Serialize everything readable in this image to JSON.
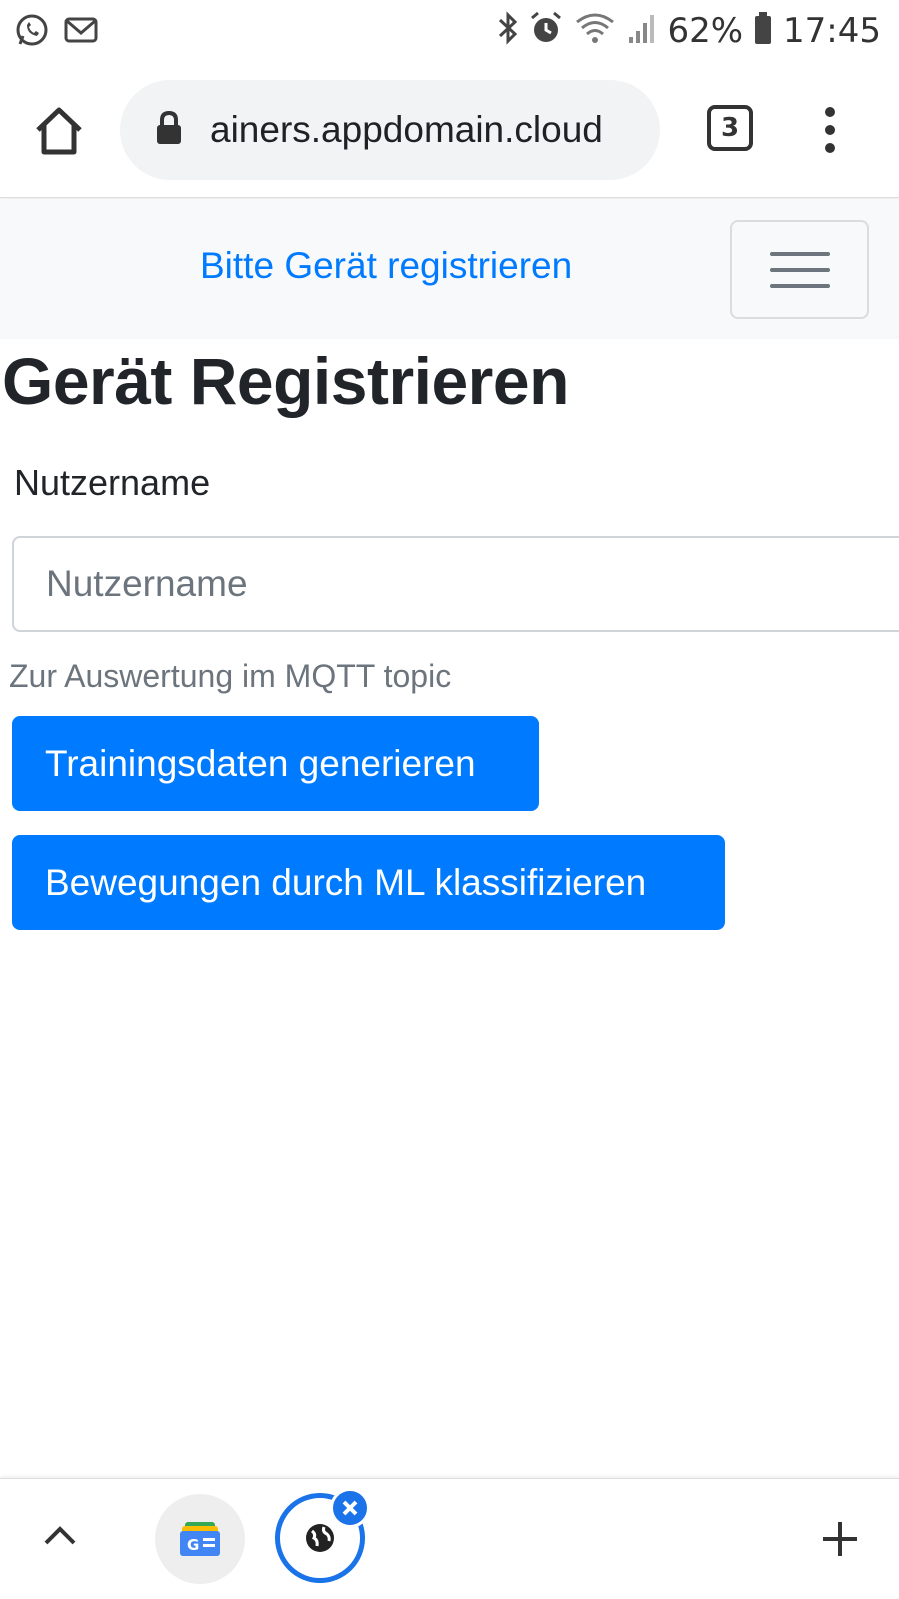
{
  "status_bar": {
    "battery": "62%",
    "time": "17:45",
    "left_icons": [
      "whatsapp-icon",
      "gmail-icon"
    ],
    "right_icons": [
      "bluetooth-icon",
      "alarm-icon",
      "wifi-icon",
      "signal-icon",
      "battery-icon"
    ]
  },
  "browser": {
    "url": "ainers.appdomain.cloud",
    "tab_count": "3"
  },
  "navbar": {
    "brand": "Bitte Gerät registrieren"
  },
  "main": {
    "title": "Gerät Registrieren",
    "username_label": "Nutzername",
    "username_placeholder": "Nutzername",
    "username_value": "",
    "help_text": "Zur Auswertung im MQTT topic",
    "buttons": {
      "train": "Trainingsdaten generieren",
      "classify": "Bewegungen durch ML klassifizieren"
    }
  },
  "colors": {
    "primary": "#007bff",
    "navbar_bg": "#f8f9fa",
    "tab_accent": "#1a73e8"
  }
}
